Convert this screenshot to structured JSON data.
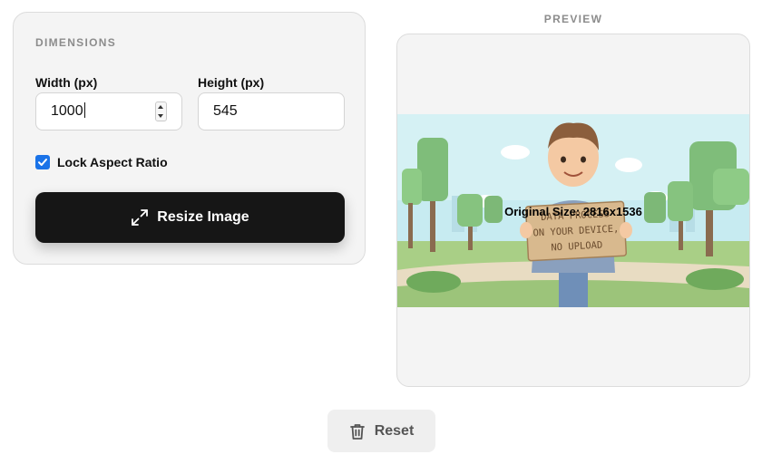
{
  "dimensions": {
    "section_title": "DIMENSIONS",
    "width_label": "Width (px)",
    "width_value": "1000",
    "height_label": "Height (px)",
    "height_value": "545",
    "lock_label": "Lock Aspect Ratio",
    "lock_checked": true,
    "resize_label": "Resize Image"
  },
  "preview": {
    "title": "PREVIEW",
    "original_size": "Original Size: 2816x1536",
    "sign_lines": [
      "DATA PROCESS",
      "ON YOUR DEVICE,",
      "NO UPLOAD"
    ]
  },
  "reset_label": "Reset",
  "colors": {
    "accent": "#1a73e8",
    "primary_button": "#161616",
    "sky": "#bfe6ee",
    "grass": "#a9cf86"
  },
  "icons": {
    "resize": "expand-arrows-icon",
    "reset": "trash-icon",
    "checkbox": "checkmark-icon"
  }
}
